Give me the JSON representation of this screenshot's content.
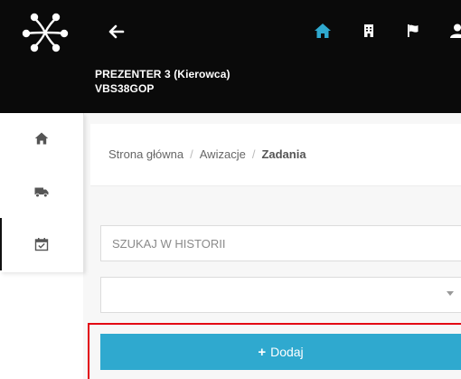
{
  "header": {
    "user_name": "PREZENTER 3 (Kierowca)",
    "vehicle_plate": "VBS38GOP",
    "icons": [
      "app-logo-icon",
      "back-arrow-icon",
      "home-icon",
      "document-icon",
      "flag-icon",
      "user-icon"
    ],
    "active_icon_color": "#2fa9cf"
  },
  "sidebar": {
    "items": [
      {
        "name": "home-icon",
        "active": false
      },
      {
        "name": "truck-icon",
        "active": false
      },
      {
        "name": "calendar-check-icon",
        "active": true
      }
    ]
  },
  "breadcrumb": {
    "items": [
      "Strona główna",
      "Awizacje"
    ],
    "separator": "/",
    "current": "Zadania"
  },
  "search": {
    "placeholder": "SZUKAJ W HISTORII"
  },
  "select": {
    "value": ""
  },
  "add_button": {
    "label": "Dodaj",
    "color": "#2fa9cf"
  },
  "highlight_color": "#e30613"
}
